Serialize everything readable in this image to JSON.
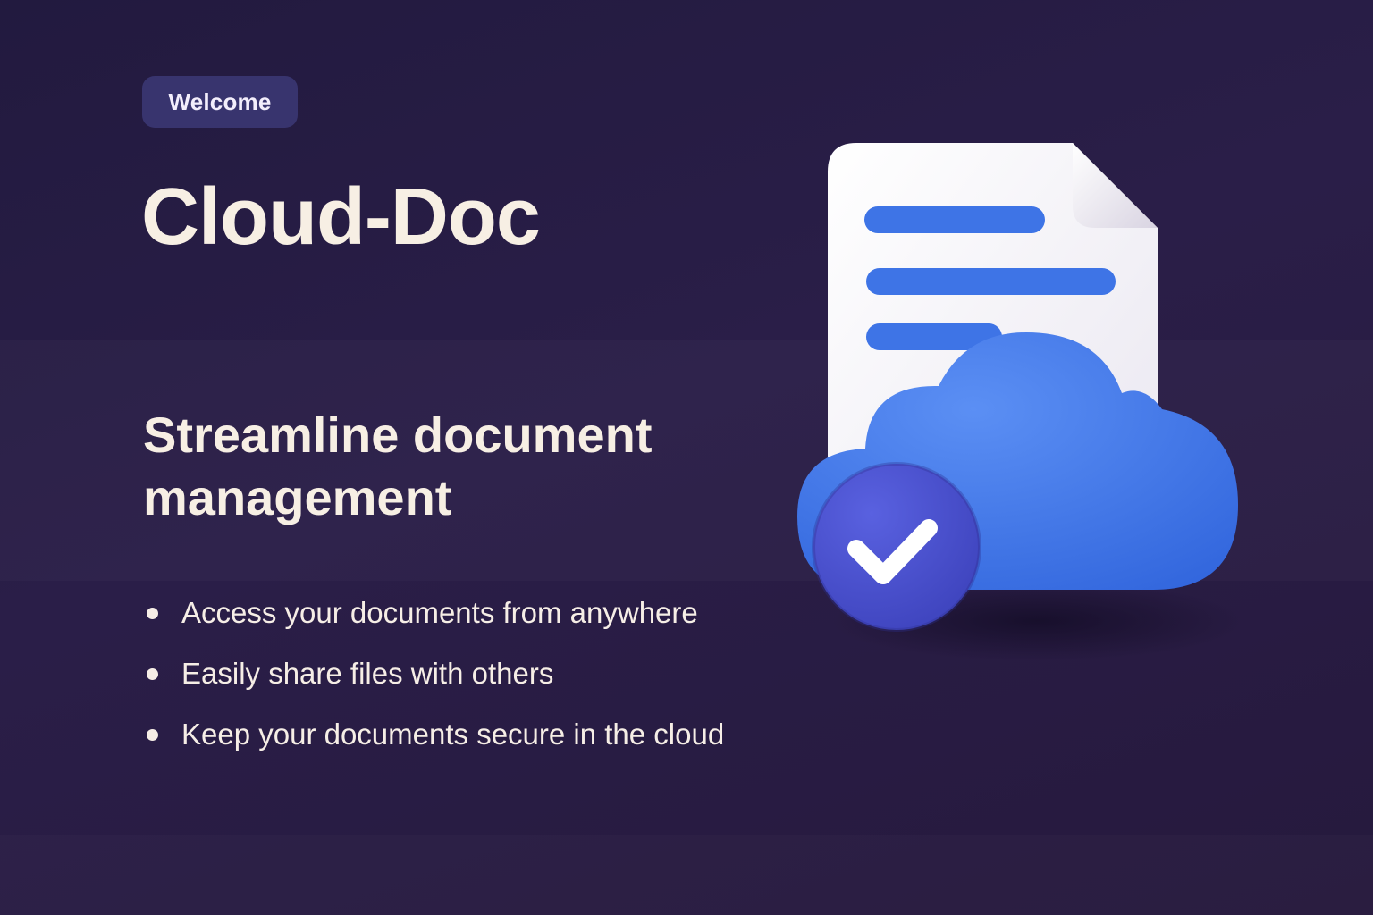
{
  "badge": {
    "label": "Welcome"
  },
  "app": {
    "title": "Cloud-Doc"
  },
  "subtitle": "Streamline document management",
  "features": [
    "Access your documents from anywhere",
    "Easily share files with others",
    "Keep your documents secure in the cloud"
  ],
  "illustration": {
    "icons": [
      "document-icon",
      "cloud-icon",
      "checkmark-icon"
    ],
    "colors": {
      "background": "#251a42",
      "accent_blue": "#3e74e6",
      "check_circle": "#4952cf",
      "text": "#f7efe4"
    }
  }
}
